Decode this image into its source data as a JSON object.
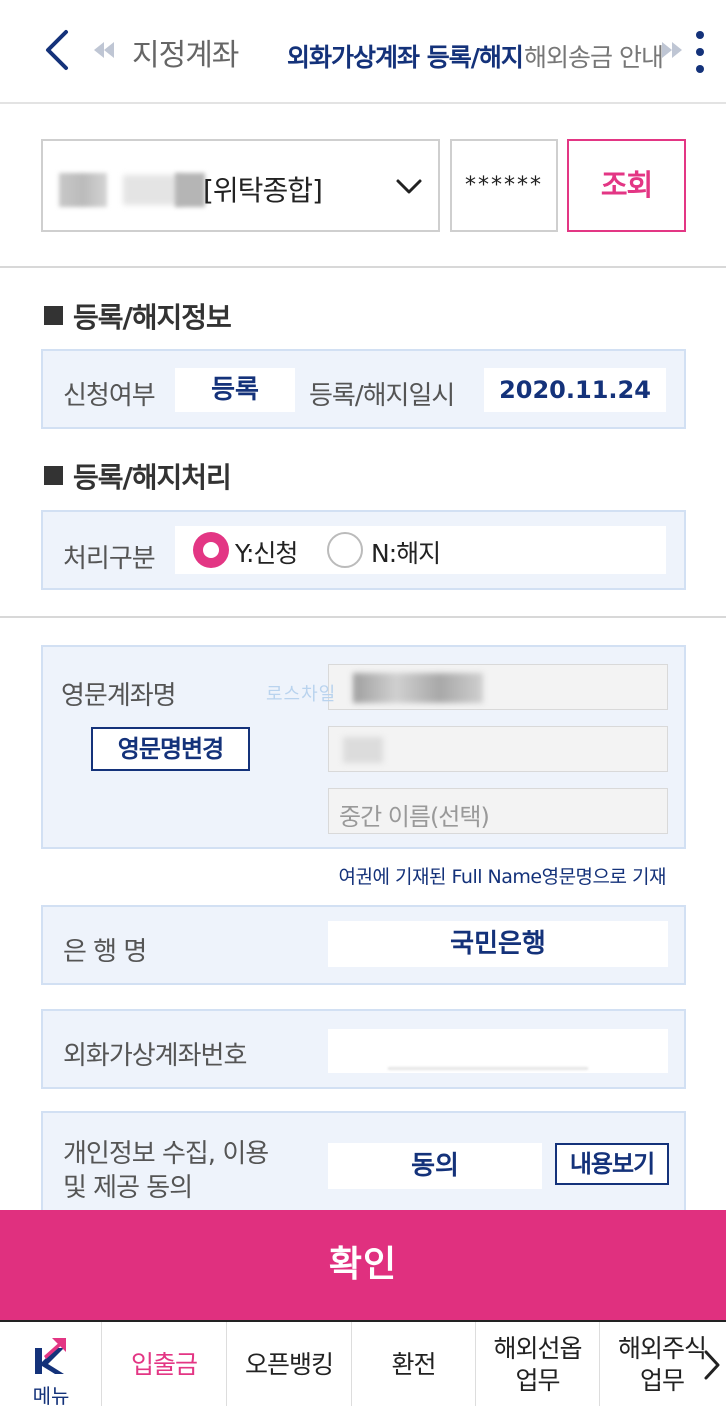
{
  "header": {
    "tabs": [
      {
        "label": "지정계좌"
      },
      {
        "label": "외화가상계좌 등록/해지"
      },
      {
        "label": "해외송금 안내"
      }
    ]
  },
  "account": {
    "type_label": "[위탁종합]",
    "password_mask": "******",
    "search_label": "조회"
  },
  "registration_info": {
    "title": "등록/해지정보",
    "apply_label": "신청여부",
    "apply_value": "등록",
    "date_label": "등록/해지일시",
    "date_value": "2020.11.24"
  },
  "processing": {
    "title": "등록/해지처리",
    "type_label": "처리구분",
    "options": [
      {
        "label": "Y:신청",
        "selected": true
      },
      {
        "label": "N:해지",
        "selected": false
      }
    ]
  },
  "english_name": {
    "label": "영문계좌명",
    "change_label": "영문명변경",
    "middle_placeholder": "중간 이름(선택)",
    "note": "여권에 기재된 Full Name영문명으로 기재",
    "watermark": "로스차일"
  },
  "bank": {
    "label": "은 행 명",
    "value": "국민은행"
  },
  "virtual_account": {
    "label": "외화가상계좌번호"
  },
  "consent": {
    "label_line1": "개인정보 수집, 이용",
    "label_line2": "및 제공 동의",
    "value": "동의",
    "view_label": "내용보기"
  },
  "confirm_label": "확인",
  "bottom_nav": {
    "menu_label": "메뉴",
    "items": [
      {
        "label": "입출금",
        "active": true
      },
      {
        "label": "오픈뱅킹",
        "active": false
      },
      {
        "label": "환전",
        "active": false
      },
      {
        "label": "해외선옵\n업무",
        "active": false
      },
      {
        "label": "해외주식\n업무",
        "active": false
      }
    ]
  },
  "colors": {
    "brand_pink": "#e33684",
    "navy": "#14327a",
    "panel_bg": "#eef3fb"
  }
}
